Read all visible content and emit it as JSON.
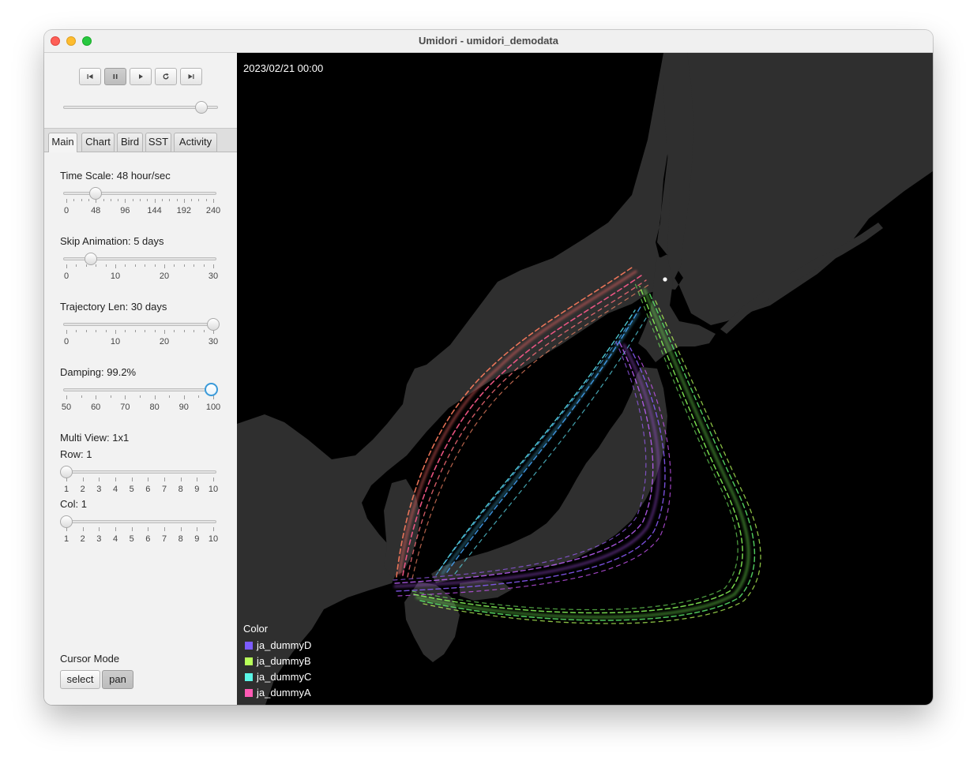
{
  "window": {
    "title": "Umidori - umidori_demodata"
  },
  "transport": {
    "buttons": [
      {
        "name": "skip-start-button",
        "icon": "skip-start-icon"
      },
      {
        "name": "pause-button",
        "icon": "pause-icon"
      },
      {
        "name": "play-button",
        "icon": "play-icon"
      },
      {
        "name": "reload-button",
        "icon": "reload-icon"
      },
      {
        "name": "skip-end-button",
        "icon": "skip-end-icon"
      }
    ],
    "playback_position": 0.93
  },
  "tabs": [
    "Main",
    "Chart",
    "Bird",
    "SST",
    "Activity"
  ],
  "selected_tab": "Main",
  "controls": {
    "time_scale": {
      "label": "Time Scale: 48 hour/sec",
      "min": 0,
      "max": 240,
      "value": 48,
      "tick_labels": [
        "0",
        "48",
        "96",
        "144",
        "192",
        "240"
      ]
    },
    "skip_animation": {
      "label": "Skip Animation: 5 days",
      "min": 0,
      "max": 30,
      "value": 5,
      "tick_labels": [
        "0",
        "10",
        "20",
        "30"
      ]
    },
    "trajectory_len": {
      "label": "Trajectory Len: 30 days",
      "min": 0,
      "max": 30,
      "value": 30,
      "tick_labels": [
        "0",
        "10",
        "20",
        "30"
      ]
    },
    "damping": {
      "label": "Damping: 99.2%",
      "min": 50,
      "max": 100,
      "value": 99.2,
      "tick_labels": [
        "50",
        "60",
        "70",
        "80",
        "90",
        "100"
      ]
    },
    "multi_view": {
      "label": "Multi View: 1x1"
    },
    "row": {
      "label": "Row: 1",
      "min": 1,
      "max": 10,
      "value": 1,
      "tick_labels": [
        "1",
        "2",
        "3",
        "4",
        "5",
        "6",
        "7",
        "8",
        "9",
        "10"
      ]
    },
    "col": {
      "label": "Col: 1",
      "min": 1,
      "max": 10,
      "value": 1,
      "tick_labels": [
        "1",
        "2",
        "3",
        "4",
        "5",
        "6",
        "7",
        "8",
        "9",
        "10"
      ]
    }
  },
  "cursor_mode": {
    "label": "Cursor Mode",
    "options": [
      "select",
      "pan"
    ],
    "active": "pan"
  },
  "map": {
    "timestamp": "2023/02/21 00:00",
    "legend": {
      "title": "Color",
      "items": [
        {
          "name": "ja_dummyD",
          "color": "#7c5cff"
        },
        {
          "name": "ja_dummyB",
          "color": "#b8ff5a"
        },
        {
          "name": "ja_dummyC",
          "color": "#5af5e6"
        },
        {
          "name": "ja_dummyA",
          "color": "#ff5ab4"
        }
      ]
    },
    "land_color": "#2f2f2f",
    "sea_color": "#000000"
  }
}
